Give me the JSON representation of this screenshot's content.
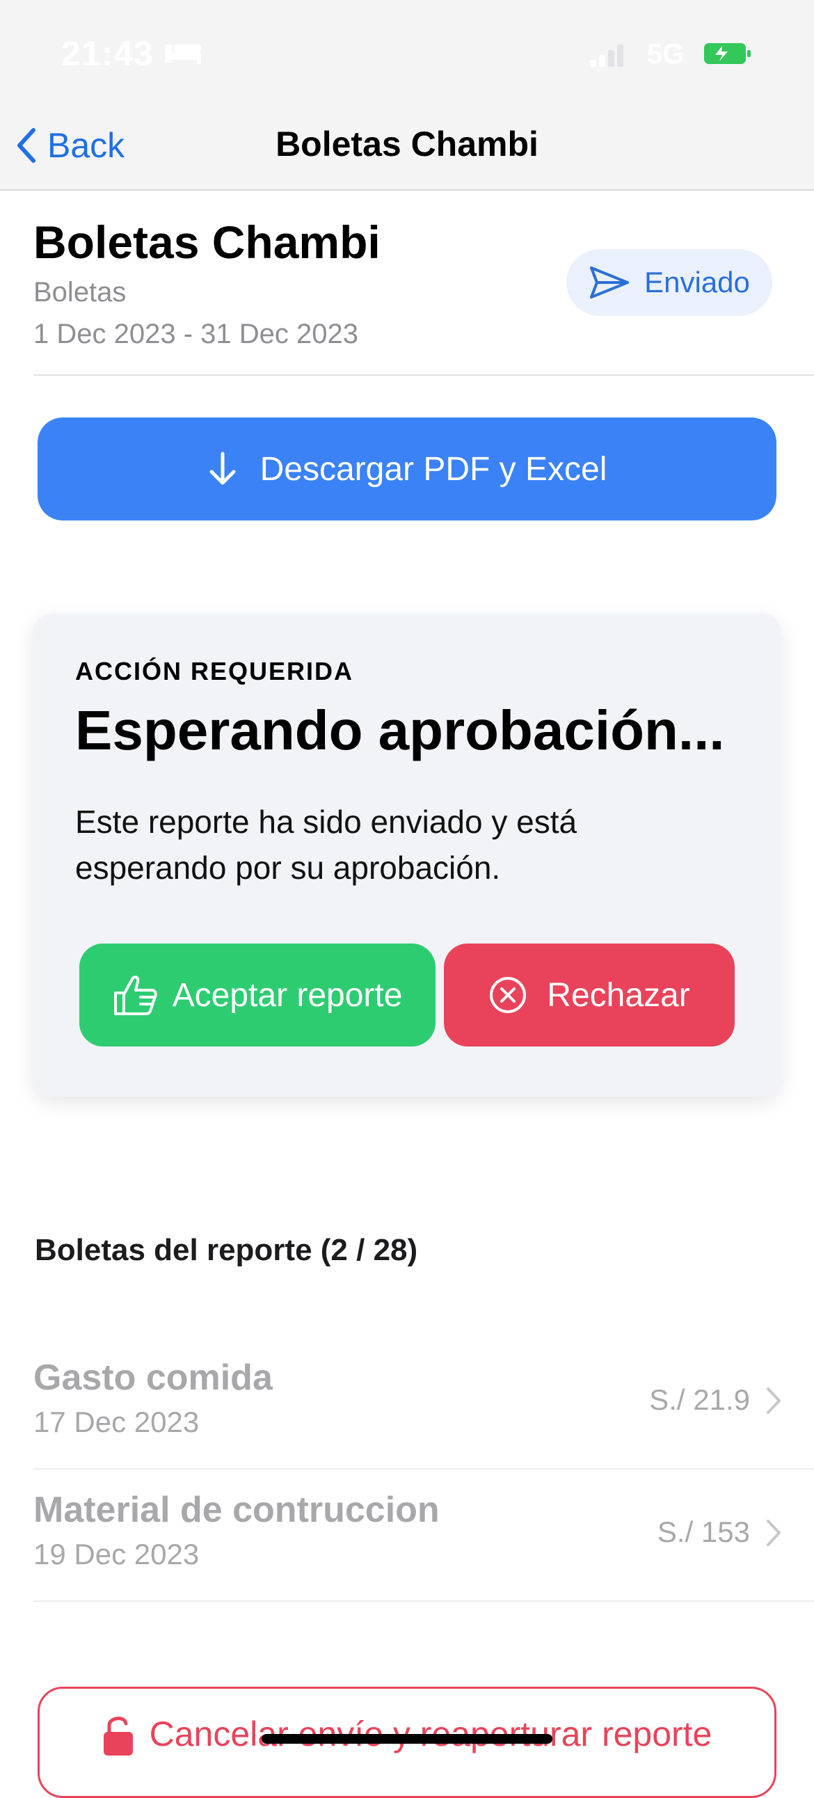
{
  "status_bar": {
    "time": "21:43",
    "network": "5G"
  },
  "nav": {
    "back_label": "Back",
    "title": "Boletas Chambi"
  },
  "report": {
    "title": "Boletas Chambi",
    "category": "Boletas",
    "dates": "1 Dec 2023 - 31 Dec 2023",
    "status": "Enviado"
  },
  "download_label": "Descargar PDF y Excel",
  "action_card": {
    "kicker": "ACCIÓN REQUERIDA",
    "title": "Esperando aprobación...",
    "body": "Este reporte ha sido enviado y está esperando por su aprobación.",
    "accept_label": "Aceptar reporte",
    "reject_label": "Rechazar"
  },
  "receipts": {
    "header": "Boletas del reporte (2 / 28)",
    "items": [
      {
        "name": "Gasto comida",
        "date": "17 Dec 2023",
        "amount": "S./ 21.9"
      },
      {
        "name": "Material de contruccion",
        "date": "19 Dec 2023",
        "amount": "S./ 153"
      }
    ]
  },
  "cancel_label": "Cancelar envío y reaperturar reporte",
  "colors": {
    "primary_blue": "#3b82f6",
    "accept_green": "#2ecc71",
    "reject_red": "#e8435a",
    "link_blue": "#1f6fe5",
    "battery_green": "#34c759"
  }
}
